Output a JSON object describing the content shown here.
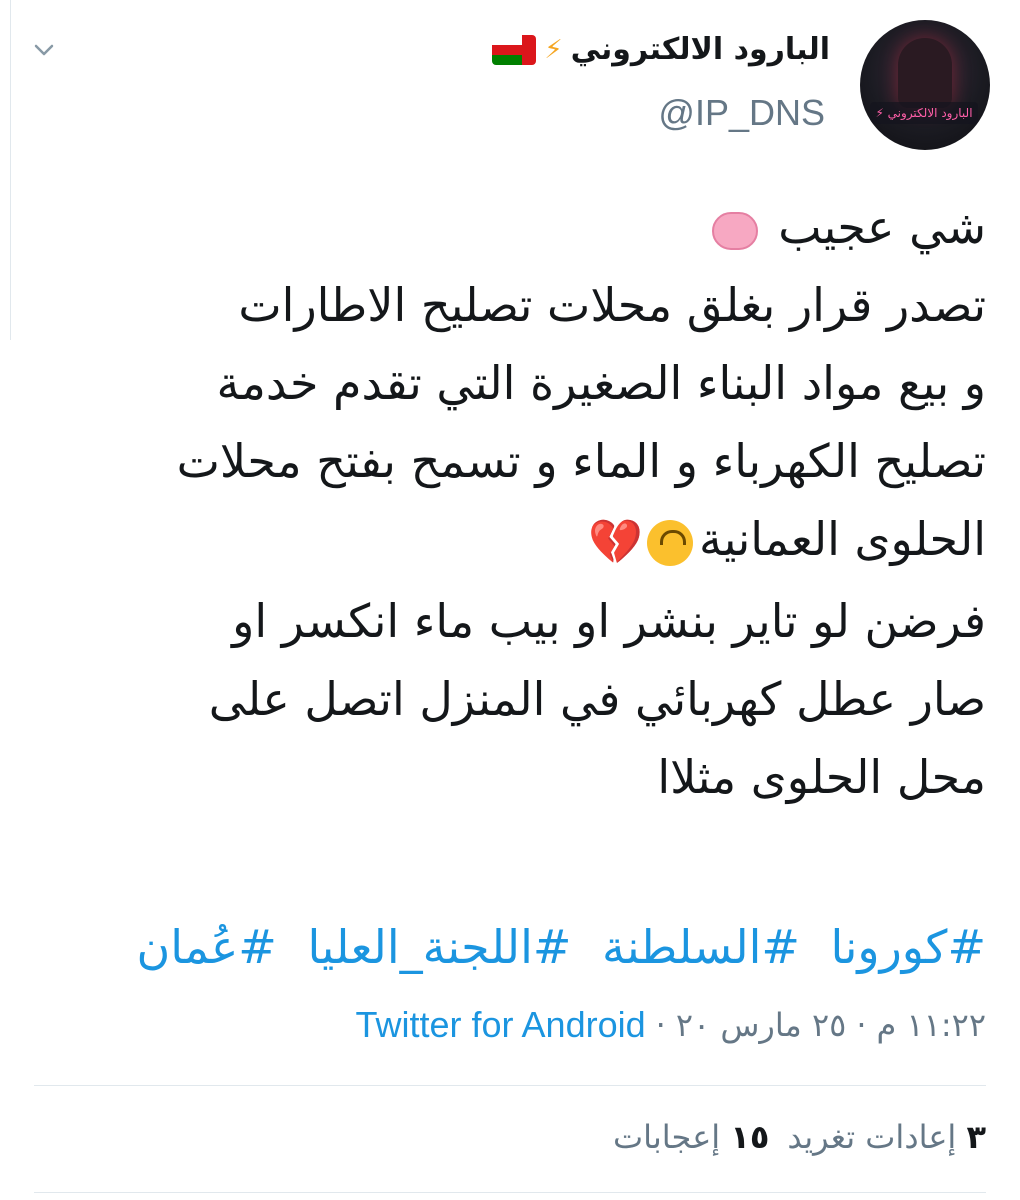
{
  "tweet": {
    "author": {
      "display_name": "البارود الالكتروني",
      "name_emoji": "⚡",
      "flag": "oman-flag",
      "handle": "@IP_DNS",
      "avatar_text": "البارود الالكتروني ⚡"
    },
    "menu_icon": "chevron-down-icon",
    "body_lines": [
      "شي عجيب",
      "تصدر قرار بغلق محلات تصليح الاطارات",
      "و بيع مواد البناء الصغيرة التي تقدم خدمة",
      "تصليح الكهرباء و الماء و تسمح بفتح محلات",
      "الحلوى العمانية",
      "فرضن لو تاير بنشر او بيب ماء انكسر او",
      "صار عطل كهربائي في المنزل اتصل على",
      "محل الحلوى مثلاا"
    ],
    "emojis": {
      "brain": "brain-emoji",
      "face": "upside-down-face-emoji",
      "heart": "💔"
    },
    "hashtags": [
      "#كورونا",
      "#السلطنة",
      "#اللجنة_العليا",
      "#عُمان"
    ],
    "timestamp": "١١:٢٢ م",
    "date": "٢٥ مارس ٢٠",
    "separator": "·",
    "source": "Twitter for Android",
    "stats": {
      "retweets_count": "٣",
      "retweets_label": "إعادات تغريد",
      "likes_count": "١٥",
      "likes_label": "إعجابات"
    }
  },
  "colors": {
    "link": "#1b95e0",
    "text": "#14171a",
    "muted": "#657786",
    "divider": "#e1e8ed"
  }
}
